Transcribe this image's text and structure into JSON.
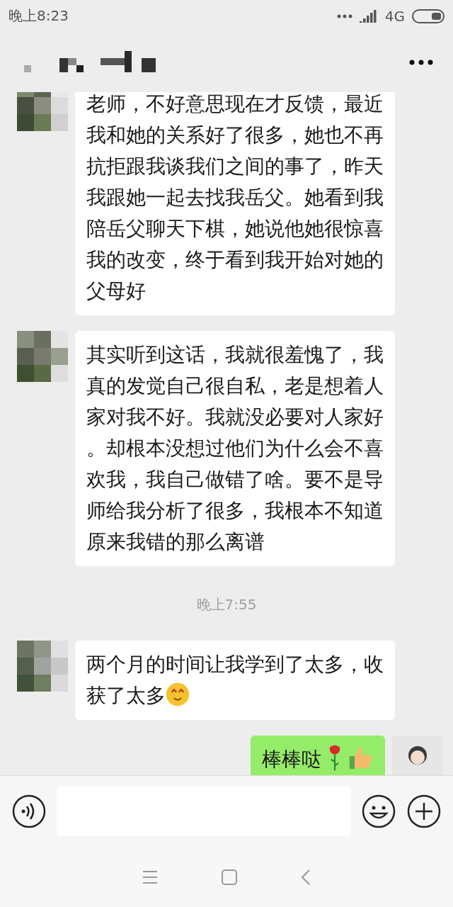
{
  "status_bar": {
    "time": "晚上8:23",
    "network": "4G"
  },
  "messages": [
    {
      "kind": "incoming",
      "text": "老师，不好意思现在才反馈，最近我和她的关系好了很多，她也不再抗拒跟我谈我们之间的事了，昨天我跟她一起去找我岳父。她看到我陪岳父聊天下棋，她说他她很惊喜我的改变，终于看到我开始对她的父母好"
    },
    {
      "kind": "incoming",
      "text": "其实听到这话，我就很羞愧了，我真的发觉自己很自私，老是想着人家对我不好。我就没必要对人家好。却根本没想过他们为什么会不喜欢我，我自己做错了啥。要不是导师给我分析了很多，我根本不知道原来我错的那么离谱"
    },
    {
      "kind": "timestamp",
      "text": "晚上7:55"
    },
    {
      "kind": "incoming",
      "text": "两个月的时间让我学到了太多，收获了太多",
      "emojis": [
        {
          "kind": "smile"
        }
      ]
    },
    {
      "kind": "outgoing",
      "text": "棒棒哒",
      "emojis": [
        {
          "kind": "rose"
        },
        {
          "kind": "thumb"
        }
      ]
    }
  ]
}
